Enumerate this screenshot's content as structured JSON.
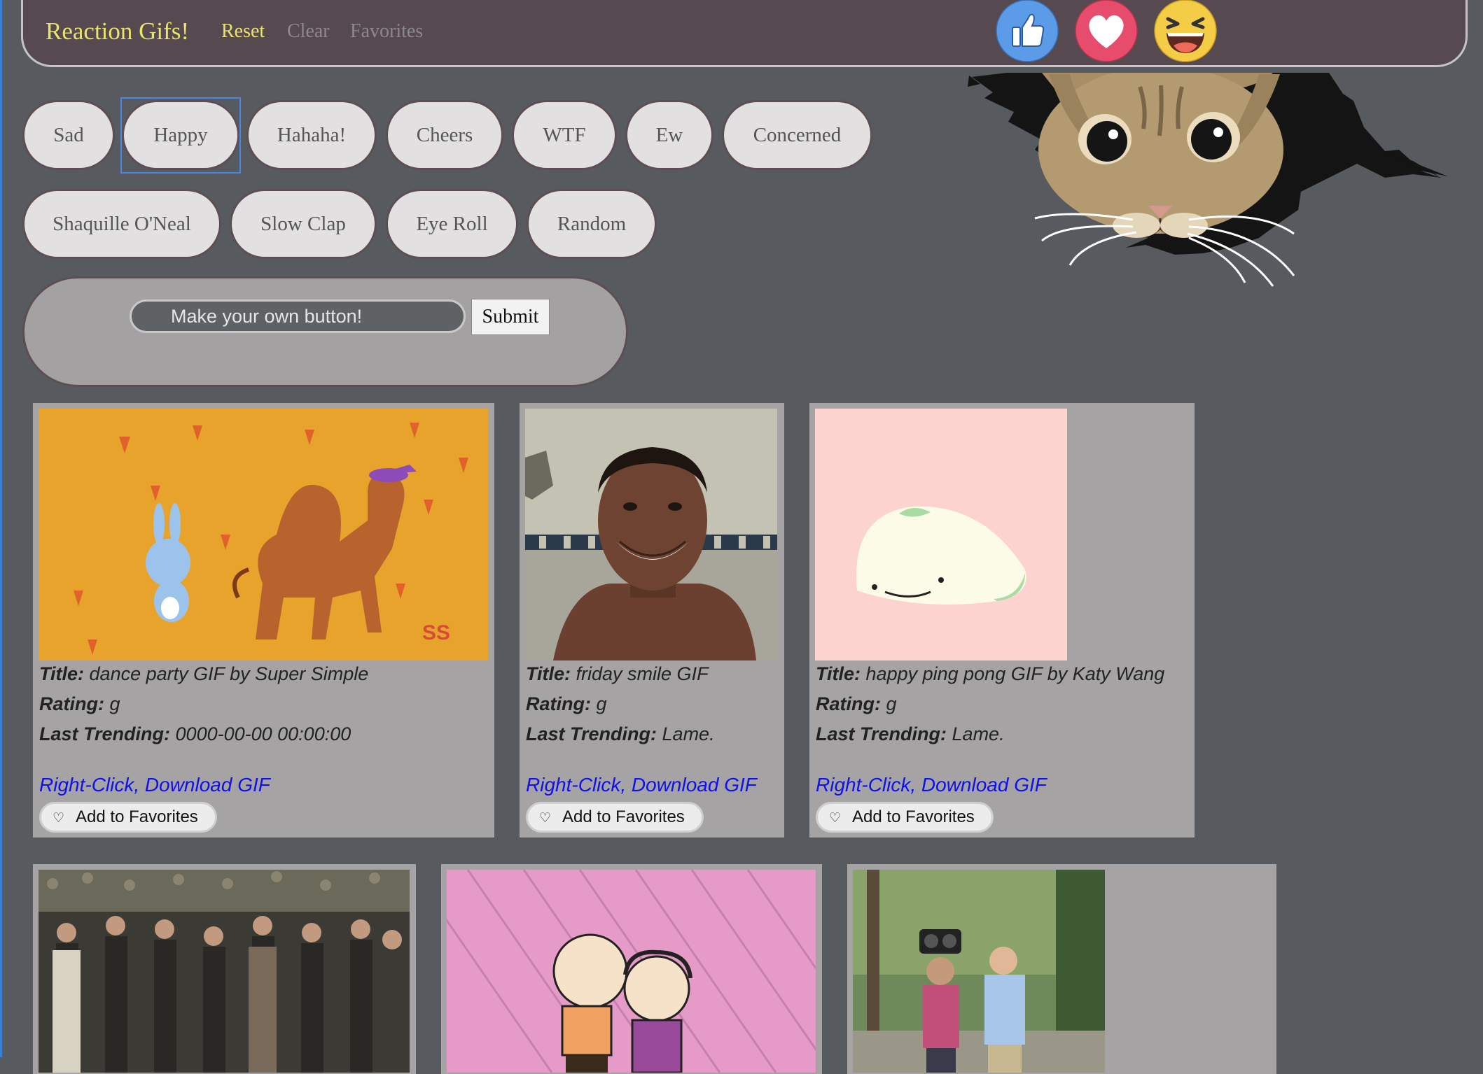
{
  "app": {
    "title": "Reaction Gifs!"
  },
  "nav": {
    "reset": "Reset",
    "clear": "Clear",
    "favorites": "Favorites"
  },
  "reactions": [
    {
      "icon": "thumbs-up-icon",
      "color": "#5b9be8"
    },
    {
      "icon": "heart-icon",
      "color": "#e84c6c"
    },
    {
      "icon": "laughing-face-icon",
      "color": "#f4cc45"
    }
  ],
  "topic_buttons": [
    "Sad",
    "Happy",
    "Hahaha!",
    "Cheers",
    "WTF",
    "Ew",
    "Concerned",
    "Shaquille O'Neal",
    "Slow Clap",
    "Eye Roll",
    "Random"
  ],
  "selected_topic": "Happy",
  "custom_form": {
    "placeholder": "Make your own button!",
    "submit_label": "Submit"
  },
  "labels": {
    "title": "Title:",
    "rating": "Rating:",
    "last_trending": "Last Trending:",
    "download": "Right-Click, Download GIF",
    "add_favorite": "Add to Favorites",
    "heart_glyph": "♡"
  },
  "gifs": [
    {
      "title": "dance party GIF by Super Simple",
      "rating": "g",
      "last_trending": "0000-00-00 00:00:00"
    },
    {
      "title": "friday smile GIF",
      "rating": "g",
      "last_trending": "Lame."
    },
    {
      "title": "happy ping pong GIF by Katy Wang",
      "rating": "g",
      "last_trending": "Lame."
    }
  ],
  "colors": {
    "background": "#575a5e",
    "navbar": "#564a50",
    "brand": "#e9e46a",
    "pill": "#e2e0e1",
    "card": "#a5a3a4",
    "link": "#1010ee"
  }
}
